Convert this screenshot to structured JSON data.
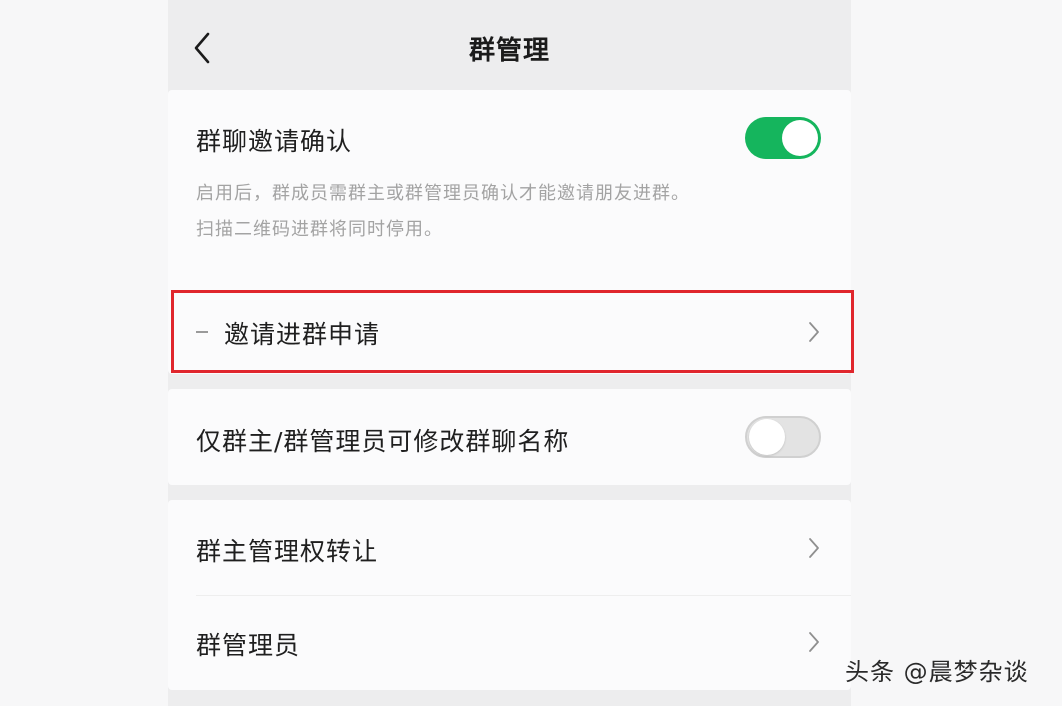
{
  "header": {
    "title": "群管理",
    "back_icon": "chevron-left-icon"
  },
  "invite_confirm": {
    "title": "群聊邀请确认",
    "description_line1": "启用后，群成员需群主或群管理员确认才能邀请朋友进群。",
    "description_line2": "扫描二维码进群将同时停用。",
    "toggle_state": "on",
    "toggle_color": "#15b55d"
  },
  "invite_requests": {
    "label": "邀请进群申请",
    "highlight_color": "#e0262d"
  },
  "rename_permission": {
    "label": "仅群主/群管理员可修改群聊名称",
    "toggle_state": "off"
  },
  "menu": {
    "transfer_owner": "群主管理权转让",
    "admins": "群管理员"
  },
  "watermark": "头条 @晨梦杂谈"
}
